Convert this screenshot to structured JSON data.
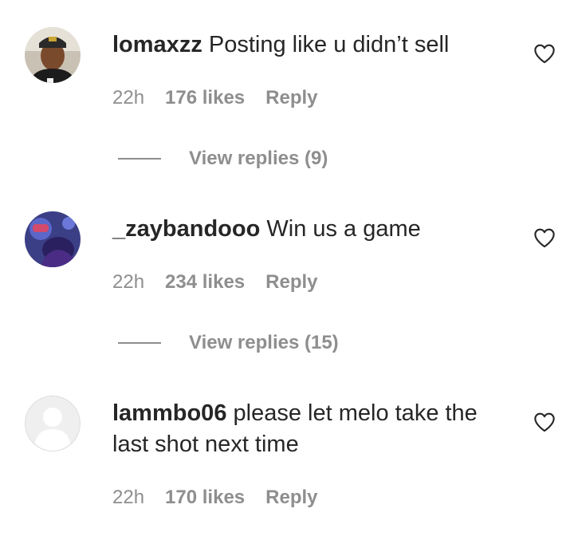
{
  "comments": [
    {
      "username": "lomaxzz",
      "text": "Posting like u didn’t sell",
      "time": "22h",
      "likes": "176 likes",
      "reply_label": "Reply",
      "view_replies": "View replies (9)",
      "avatar_icon": "profile-photo"
    },
    {
      "username": "_zaybandooo",
      "text": "Win us a game",
      "time": "22h",
      "likes": "234 likes",
      "reply_label": "Reply",
      "view_replies": "View replies (15)",
      "avatar_icon": "profile-photo"
    },
    {
      "username": "lammbo06",
      "text": "please let melo take the last shot next time",
      "time": "22h",
      "likes": "170 likes",
      "reply_label": "Reply",
      "avatar_icon": "default-avatar"
    }
  ],
  "colors": {
    "text": "#262626",
    "secondary": "#8e8e8e",
    "divider": "#8e8e8e"
  }
}
